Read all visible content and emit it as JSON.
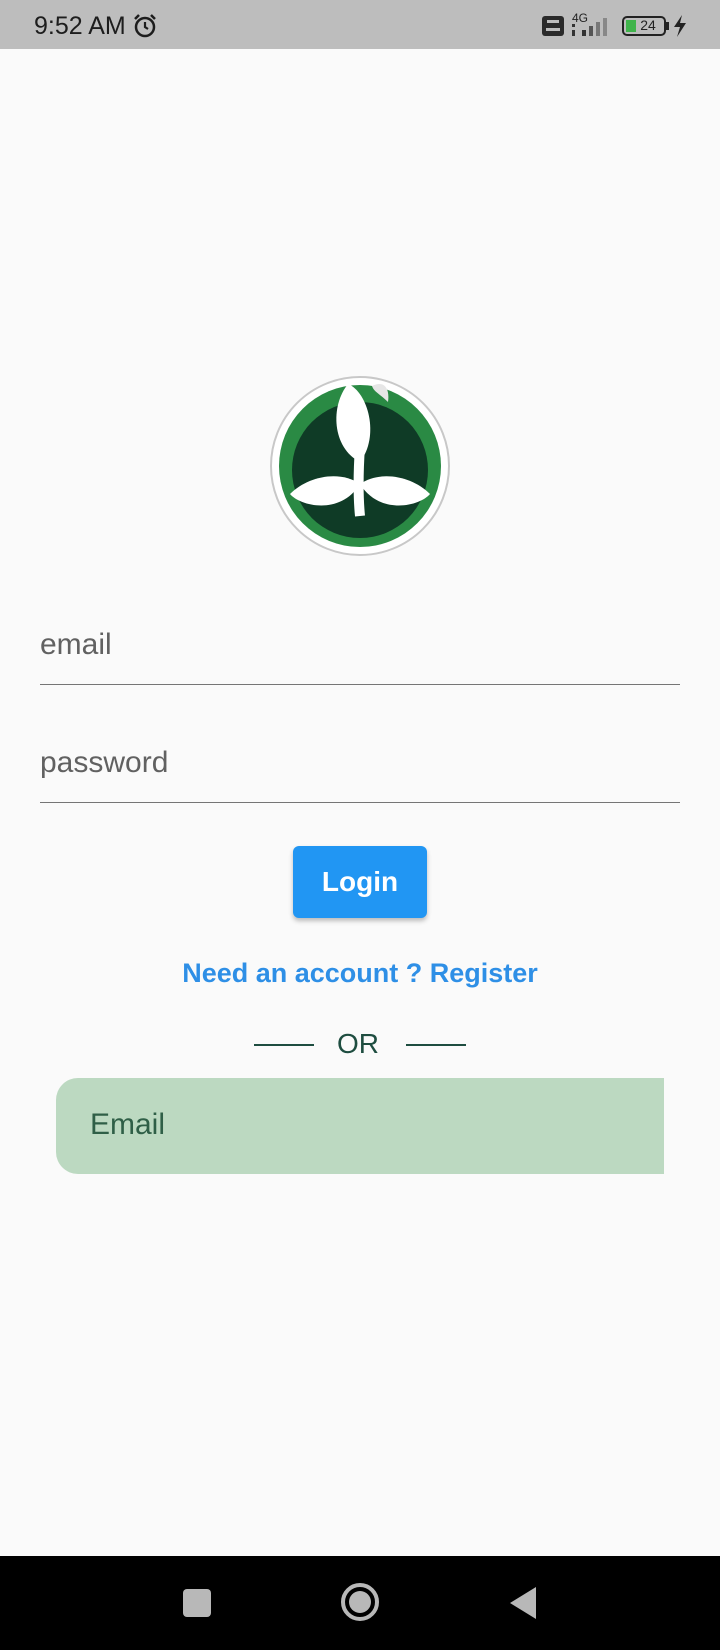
{
  "status_bar": {
    "time": "9:52 AM",
    "network": "4G",
    "battery": "24",
    "icons": [
      "alarm-icon",
      "volte-icon",
      "signal-icon",
      "battery-icon",
      "charging-icon"
    ]
  },
  "logo": {
    "icon": "plant-leaf-logo"
  },
  "form": {
    "email_placeholder": "email",
    "password_placeholder": "password",
    "login_label": "Login",
    "register_text": "Need an account ? Register",
    "or_text": "OR",
    "email_box_placeholder": "Email"
  },
  "nav_bar": {
    "icons": [
      "recent-apps-icon",
      "home-icon",
      "back-icon"
    ]
  },
  "colors": {
    "primary": "#2196f3",
    "link": "#2e8fe6",
    "green_box": "#bcd9c1",
    "status_bar": "#bdbdbd"
  }
}
